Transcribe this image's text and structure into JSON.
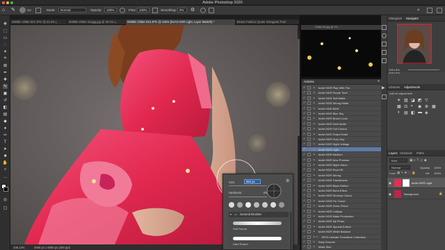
{
  "app": {
    "title": "Adobe Photoshop 2020"
  },
  "options_bar": {
    "brush_size": "552",
    "mode_label": "Mode:",
    "mode_value": "Normal",
    "opacity_label": "Opacity:",
    "opacity_value": "100%",
    "flow_label": "Flow:",
    "flow_value": "100%",
    "smoothing_label": "Smoothing:",
    "smoothing_value": "0%"
  },
  "tabs": [
    {
      "label": "0000lie Glitter 007.JPG @ 33.2% (..."
    },
    {
      "label": "0000lie Glitter 011jpg.jpg @ 33.2% (..."
    },
    {
      "label": "0000lie Glitter 010.JPG @ 105% (beArt HDR Light, Layer Mask/8) *"
    },
    {
      "label": "Brown Fashion Quote Instagram Post"
    }
  ],
  "status": {
    "zoom": "105.13%",
    "doc_size": "4000 px x 6000 px (300 ppi)"
  },
  "mini_doc": {
    "title": "Glitter 50.jpg @ 23..."
  },
  "actions_panel": {
    "title": "Actions",
    "items": [
      {
        "label": "beArt HDR Play With Fire",
        "selected": false,
        "folder": false
      },
      {
        "label": "beArt HDR Purple Tone",
        "selected": false,
        "folder": false
      },
      {
        "label": "beArt HDR Soft Matte",
        "selected": false,
        "folder": false
      },
      {
        "label": "beArt HDR Strong Matte",
        "selected": false,
        "folder": false
      },
      {
        "label": "beArt HDR B&W",
        "selected": false,
        "folder": false
      },
      {
        "label": "beArt HDR Blue Sky",
        "selected": false,
        "folder": false
      },
      {
        "label": "beArt HDR Brown Look",
        "selected": false,
        "folder": false
      },
      {
        "label": "beArt HDR Dark Matte",
        "selected": false,
        "folder": false
      },
      {
        "label": "beArt HDR Full Control",
        "selected": false,
        "folder": false
      },
      {
        "label": "beArt HDR Grand Hotel",
        "selected": false,
        "folder": false
      },
      {
        "label": "beArt HDR Grey Day",
        "selected": false,
        "folder": false
      },
      {
        "label": "beArt HDR Hight Voltage",
        "selected": false,
        "folder": false
      },
      {
        "label": "beArt HDR Light",
        "selected": true,
        "folder": false
      },
      {
        "label": "beArt HDR Medium",
        "selected": false,
        "folder": false
      },
      {
        "label": "beArt HDR New Process",
        "selected": false,
        "folder": false
      },
      {
        "label": "beArt HDR Night Vision",
        "selected": false,
        "folder": false
      },
      {
        "label": "beArt HDR Real HD",
        "selected": false,
        "folder": false
      },
      {
        "label": "beArt HDR Strong",
        "selected": false,
        "folder": false
      },
      {
        "label": "beArt HDR Transformer",
        "selected": false,
        "folder": false
      },
      {
        "label": "beArt HDR Black Edition",
        "selected": false,
        "folder": false
      },
      {
        "label": "beArt HDR Boho Effect",
        "selected": false,
        "folder": false
      },
      {
        "label": "beArt HDR Develop Colour",
        "selected": false,
        "folder": false
      },
      {
        "label": "beArt HDR For Travel",
        "selected": false,
        "folder": false
      },
      {
        "label": "beArt HDR Green Place",
        "selected": false,
        "folder": false
      },
      {
        "label": "beArt HDR Lollipop",
        "selected": false,
        "folder": false
      },
      {
        "label": "beArt HDR Make Production",
        "selected": false,
        "folder": false
      },
      {
        "label": "beArt HDR My Photo",
        "selected": false,
        "folder": false
      },
      {
        "label": "beArt HDR Special Edition",
        "selected": false,
        "folder": false
      },
      {
        "label": "beArt HDR White Balance",
        "selected": false,
        "folder": false
      },
      {
        "label": "BFGi Intimate Portraiture Collection",
        "selected": false,
        "folder": true
      },
      {
        "label": "Easy Smooth",
        "selected": false,
        "folder": false
      },
      {
        "label": "Mask Skin",
        "selected": false,
        "folder": false
      },
      {
        "label": "Bubble Layer",
        "selected": false,
        "folder": false
      }
    ]
  },
  "histogram_panel": {
    "tab_histogram": "Histogram",
    "tab_navigator": "Navigator",
    "zoom": "105.13%"
  },
  "libraries_panel": {
    "tab_libraries": "Libraries",
    "tab_adjustments": "Adjustments",
    "hint": "Add an adjustment"
  },
  "layers_panel": {
    "tab_layers": "Layers",
    "tab_channels": "Channels",
    "tab_paths": "Paths",
    "kind": "Kind",
    "blend_mode": "Normal",
    "opacity_label": "Opacity:",
    "opacity_value": "100%",
    "lock_label": "Lock:",
    "fill_label": "Fill:",
    "fill_value": "100%",
    "layers": [
      {
        "name": "beArt HDR Light"
      },
      {
        "name": "Background"
      }
    ]
  },
  "brush_popup": {
    "size_label": "Size:",
    "size_value": "552 px",
    "hardness_label": "Hardness:",
    "hardness_value": "0%",
    "folder_label": "General Brushes",
    "brush1": "Soft Round",
    "brush2": "Hard Round"
  },
  "colors": {
    "accent": "#5e7ba6",
    "dress": "#e8315b",
    "panel": "#4a4a4a"
  }
}
